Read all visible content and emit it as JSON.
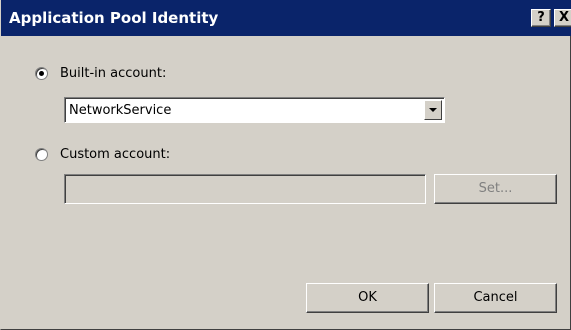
{
  "window": {
    "title": "Application Pool Identity",
    "help_label": "?",
    "close_label": "X"
  },
  "builtin": {
    "label": "Built-in account:",
    "selected": true,
    "dropdown_value": "NetworkService"
  },
  "custom": {
    "label": "Custom account:",
    "selected": false,
    "input_value": "",
    "set_button_label": "Set..."
  },
  "buttons": {
    "ok_label": "OK",
    "cancel_label": "Cancel"
  }
}
